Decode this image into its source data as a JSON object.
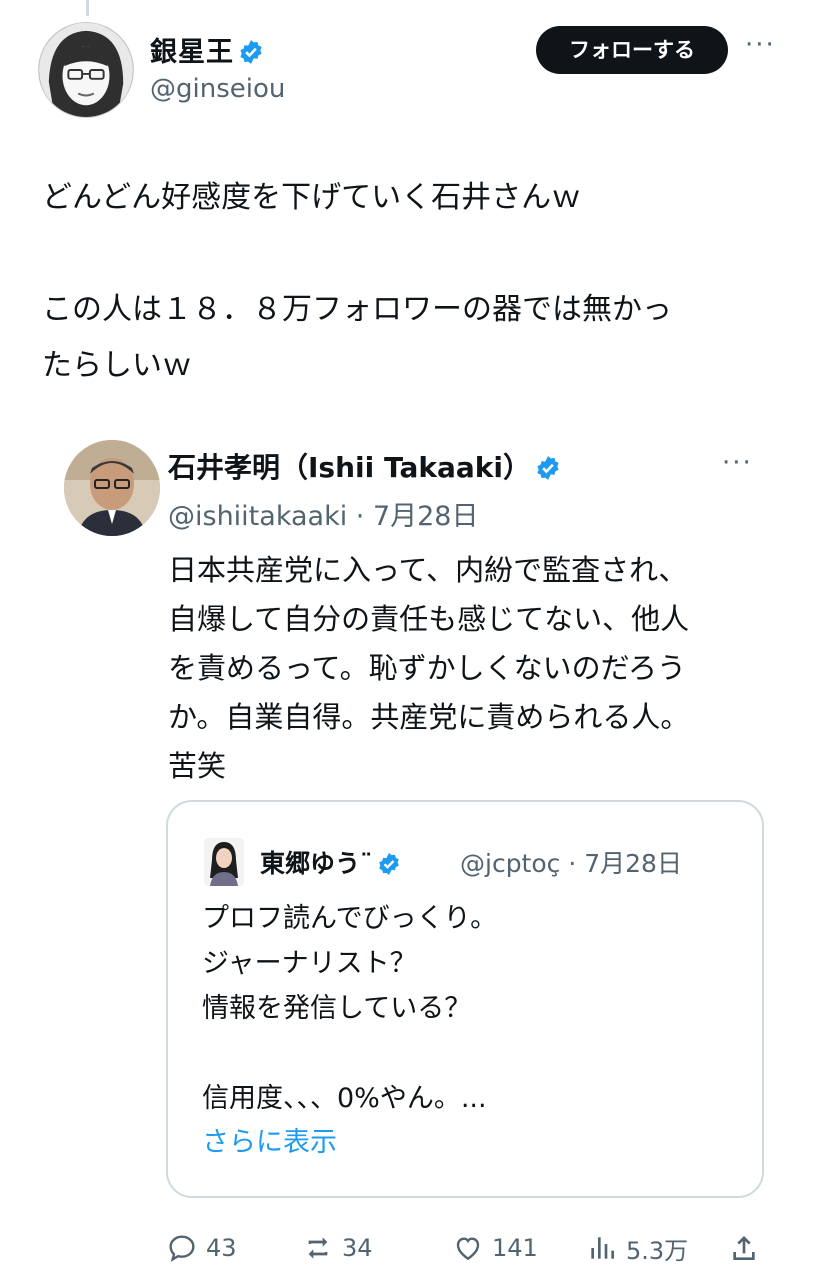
{
  "author": {
    "display_name": "銀星王",
    "handle": "@ginseiou",
    "follow_label": "フォローする",
    "more_label": "···"
  },
  "tweet": {
    "text": "どんどん好感度を下げていく石井さんｗ\n\nこの人は１８．８万フォロワーの器では無かっ\nたらしいｗ"
  },
  "quoted": {
    "display_name": "石井孝明（Ishii Takaaki）",
    "handle_date": "@ishiitakaaki · 7月28日",
    "more_label": "···",
    "text": "日本共産党に入って、内紛で監査され、\n自爆して自分の責任も感じてない、他人\nを責めるって。恥ずかしくないのだろう\nか。自業自得。共産党に責められる人。\n苦笑"
  },
  "nested_quote": {
    "display_name": "東郷ゆう̈",
    "display_name_visible": "東郷ゆう¨",
    "handle_date": "@jcptoç · 7月28日",
    "text": "プロフ読んでびっくり。\nジャーナリスト？\n情報を発信している？\n\n信用度、、、0%やん。...",
    "show_more": "さらに表示"
  },
  "actions": {
    "replies": "43",
    "reposts": "34",
    "likes": "141",
    "views": "5.3万"
  },
  "colors": {
    "accent": "#1d9bf0",
    "text": "#0f1419",
    "muted": "#536471",
    "border": "#cfd9de"
  }
}
